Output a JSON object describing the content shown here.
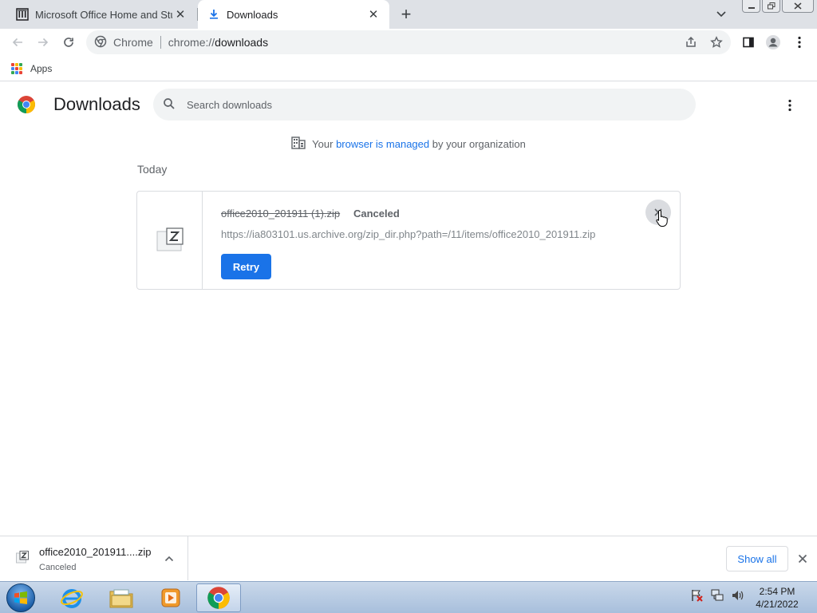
{
  "browser": {
    "tabs": [
      {
        "title": "Microsoft Office Home and Stude",
        "active": false,
        "icon": "archive-institution-icon"
      },
      {
        "title": "Downloads",
        "active": true,
        "icon": "download-arrow-icon"
      }
    ],
    "omnibox": {
      "scheme_label": "Chrome",
      "url_prefix": "chrome://",
      "url_host": "downloads"
    },
    "bookmarks": [
      {
        "label": "Apps"
      }
    ]
  },
  "page": {
    "title": "Downloads",
    "search_placeholder": "Search downloads",
    "managed_notice": {
      "before": "Your ",
      "link_text": "browser is managed",
      "after": " by your organization"
    },
    "date_header": "Today",
    "download": {
      "file_name": "office2010_201911 (1).zip",
      "status": "Canceled",
      "url": "https://ia803101.us.archive.org/zip_dir.php?path=/11/items/office2010_201911.zip",
      "retry_label": "Retry"
    }
  },
  "shelf": {
    "item_name": "office2010_201911....zip",
    "item_status": "Canceled",
    "show_all_label": "Show all"
  },
  "taskbar": {
    "time": "2:54 PM",
    "date": "4/21/2022",
    "apps": [
      "internet-explorer-icon",
      "file-explorer-icon",
      "media-player-icon",
      "chrome-icon"
    ]
  },
  "colors": {
    "accent": "#1a73e8",
    "tabstrip": "#dee1e6",
    "omnibox": "#f1f3f4"
  }
}
